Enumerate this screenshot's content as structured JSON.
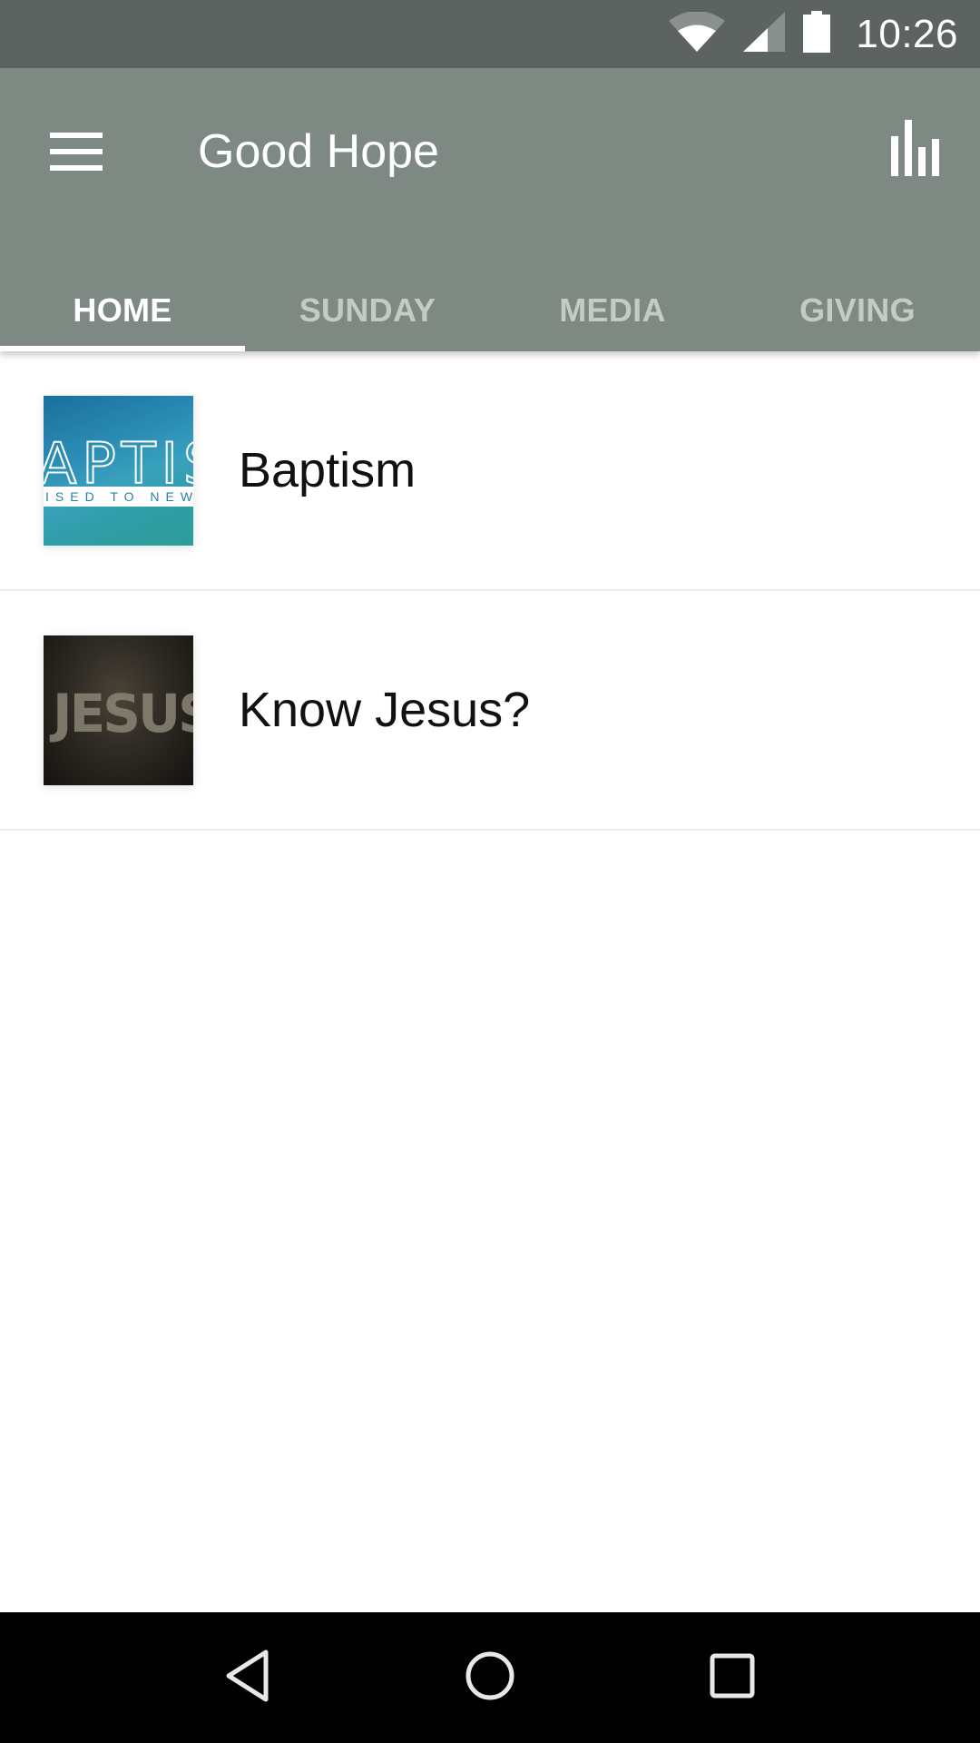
{
  "status_bar": {
    "time": "10:26",
    "icons": [
      "wifi-icon",
      "cell-signal-icon",
      "battery-icon"
    ]
  },
  "app_bar": {
    "title": "Good Hope",
    "menu_icon": "hamburger-menu-icon",
    "action_icon": "bar-chart-icon",
    "background_color": "#7f8983"
  },
  "tabs": [
    {
      "label": "HOME",
      "active": true
    },
    {
      "label": "SUNDAY",
      "active": false
    },
    {
      "label": "MEDIA",
      "active": false
    },
    {
      "label": "GIVING",
      "active": false
    }
  ],
  "list": {
    "items": [
      {
        "title": "Baptism",
        "thumbnail_text": "APTIS",
        "thumbnail_subtext": "ISED TO NEW L"
      },
      {
        "title": "Know Jesus?",
        "thumbnail_text": "JESUS"
      }
    ]
  },
  "nav_bar": {
    "back": "back-icon",
    "home": "home-icon",
    "recents": "recents-icon"
  }
}
